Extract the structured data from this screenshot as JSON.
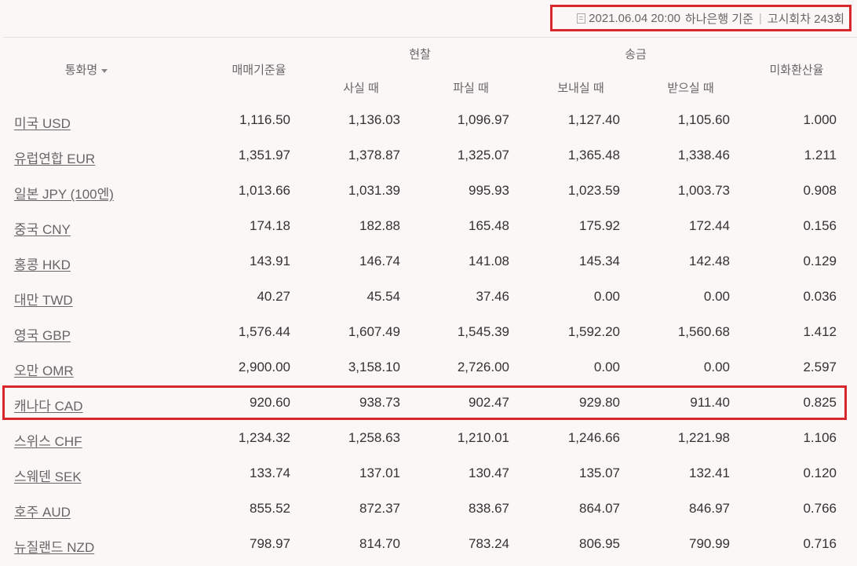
{
  "notice": {
    "datetime": "2021.06.04 20:00",
    "bank": "하나은행 기준",
    "round": "고시회차 243회"
  },
  "table_header": {
    "currency": "통화명",
    "base_rate": "매매기준율",
    "cash": "현찰",
    "remit": "송금",
    "cash_buy": "사실 때",
    "cash_sell": "파실 때",
    "remit_send": "보내실 때",
    "remit_receive": "받으실 때",
    "usd_rate": "미화환산율"
  },
  "rows": [
    {
      "name": "미국 USD",
      "base": "1,116.50",
      "cash_buy": "1,136.03",
      "cash_sell": "1,096.97",
      "send": "1,127.40",
      "receive": "1,105.60",
      "usd": "1.000"
    },
    {
      "name": "유럽연합 EUR",
      "base": "1,351.97",
      "cash_buy": "1,378.87",
      "cash_sell": "1,325.07",
      "send": "1,365.48",
      "receive": "1,338.46",
      "usd": "1.211"
    },
    {
      "name": "일본 JPY (100엔)",
      "base": "1,013.66",
      "cash_buy": "1,031.39",
      "cash_sell": "995.93",
      "send": "1,023.59",
      "receive": "1,003.73",
      "usd": "0.908"
    },
    {
      "name": "중국 CNY",
      "base": "174.18",
      "cash_buy": "182.88",
      "cash_sell": "165.48",
      "send": "175.92",
      "receive": "172.44",
      "usd": "0.156"
    },
    {
      "name": "홍콩 HKD",
      "base": "143.91",
      "cash_buy": "146.74",
      "cash_sell": "141.08",
      "send": "145.34",
      "receive": "142.48",
      "usd": "0.129"
    },
    {
      "name": "대만 TWD",
      "base": "40.27",
      "cash_buy": "45.54",
      "cash_sell": "37.46",
      "send": "0.00",
      "receive": "0.00",
      "usd": "0.036"
    },
    {
      "name": "영국 GBP",
      "base": "1,576.44",
      "cash_buy": "1,607.49",
      "cash_sell": "1,545.39",
      "send": "1,592.20",
      "receive": "1,560.68",
      "usd": "1.412"
    },
    {
      "name": "오만 OMR",
      "base": "2,900.00",
      "cash_buy": "3,158.10",
      "cash_sell": "2,726.00",
      "send": "0.00",
      "receive": "0.00",
      "usd": "2.597"
    },
    {
      "name": "캐나다 CAD",
      "base": "920.60",
      "cash_buy": "938.73",
      "cash_sell": "902.47",
      "send": "929.80",
      "receive": "911.40",
      "usd": "0.825"
    },
    {
      "name": "스위스 CHF",
      "base": "1,234.32",
      "cash_buy": "1,258.63",
      "cash_sell": "1,210.01",
      "send": "1,246.66",
      "receive": "1,221.98",
      "usd": "1.106"
    },
    {
      "name": "스웨덴 SEK",
      "base": "133.74",
      "cash_buy": "137.01",
      "cash_sell": "130.47",
      "send": "135.07",
      "receive": "132.41",
      "usd": "0.120"
    },
    {
      "name": "호주 AUD",
      "base": "855.52",
      "cash_buy": "872.37",
      "cash_sell": "838.67",
      "send": "864.07",
      "receive": "846.97",
      "usd": "0.766"
    },
    {
      "name": "뉴질랜드 NZD",
      "base": "798.97",
      "cash_buy": "814.70",
      "cash_sell": "783.24",
      "send": "806.95",
      "receive": "790.99",
      "usd": "0.716"
    }
  ],
  "highlight_color": "#d9262b"
}
